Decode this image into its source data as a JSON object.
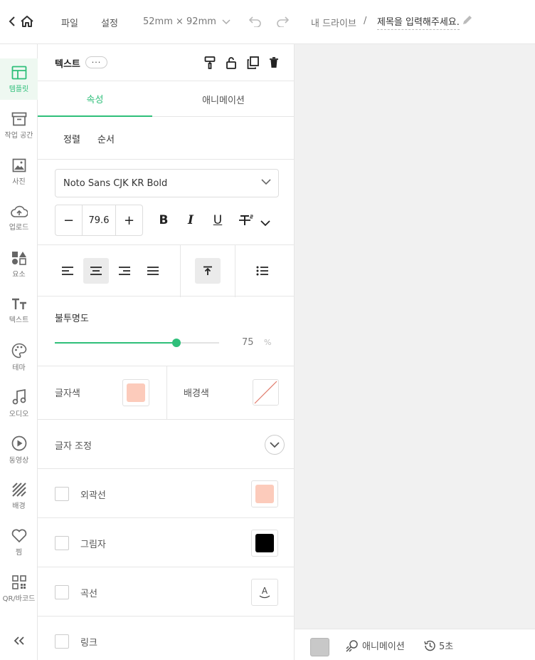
{
  "topbar": {
    "file_label": "파일",
    "settings_label": "설정",
    "size_label": "52mm × 92mm",
    "drive_label": "내 드라이브",
    "separator": "/",
    "title_placeholder": "제목을 입력해주세요."
  },
  "nav": {
    "items": [
      {
        "label": "템플릿",
        "icon": "template-icon",
        "active": true
      },
      {
        "label": "작업 공간",
        "icon": "archive-icon"
      },
      {
        "label": "사진",
        "icon": "image-icon"
      },
      {
        "label": "업로드",
        "icon": "cloud-upload-icon"
      },
      {
        "label": "요소",
        "icon": "shapes-icon"
      },
      {
        "label": "텍스트",
        "icon": "text-icon"
      },
      {
        "label": "테마",
        "icon": "palette-icon"
      },
      {
        "label": "오디오",
        "icon": "music-icon"
      },
      {
        "label": "동영상",
        "icon": "play-icon"
      },
      {
        "label": "배경",
        "icon": "background-icon"
      },
      {
        "label": "찜",
        "icon": "heart-icon"
      },
      {
        "label": "QR/바코드",
        "icon": "qr-icon"
      }
    ]
  },
  "panel": {
    "title": "텍스트",
    "more_label": "···",
    "tabs": [
      "속성",
      "애니메이션"
    ],
    "subtabs": [
      "정렬",
      "순서"
    ],
    "font": "Noto Sans CJK KR Bold",
    "font_size": "79.6",
    "minus": "−",
    "plus": "+",
    "bold": "B",
    "italic": "I",
    "underline": "U",
    "opacity_label": "불투명도",
    "opacity_value": "75",
    "opacity_unit": "%",
    "opacity_fraction": 0.74,
    "text_color_label": "글자색",
    "bg_color_label": "배경색",
    "adjust_label": "글자 조정",
    "outline_label": "외곽선",
    "shadow_label": "그림자",
    "curve_label": "곡선",
    "link_label": "링크",
    "curve_glyph": "A"
  },
  "colors": {
    "accent": "#2fbf7a",
    "text_color": "#fccbbb",
    "outline_color": "#fccbbb",
    "shadow_color": "#000000"
  },
  "bottombar": {
    "animation_label": "애니메이션",
    "duration_label": "5초"
  }
}
